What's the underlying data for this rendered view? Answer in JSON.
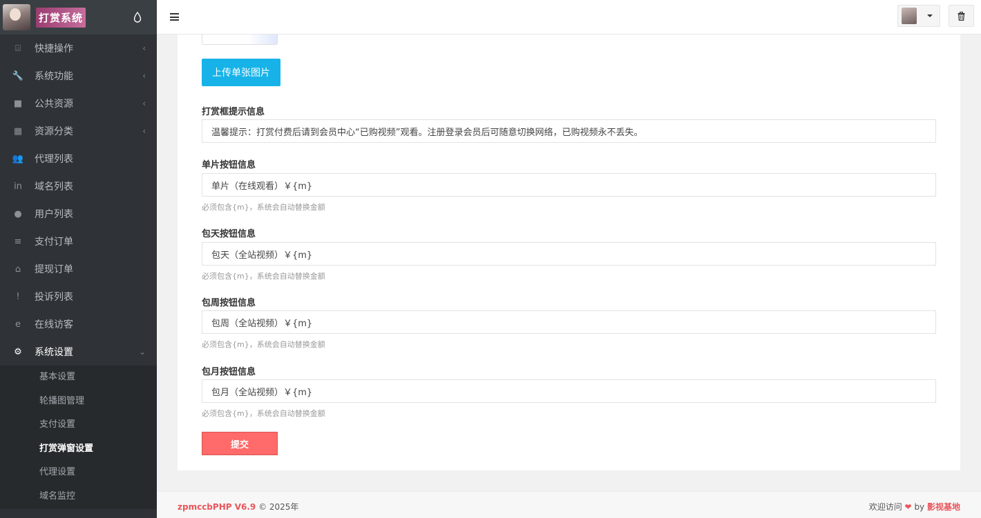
{
  "brand": {
    "title": "打赏系统"
  },
  "sidebar": {
    "items": [
      {
        "label": "快捷操作",
        "icon": "folder-open-icon",
        "glyph": "⌸",
        "has_arrow": true
      },
      {
        "label": "系统功能",
        "icon": "wrench-icon",
        "glyph": "🔧",
        "has_arrow": true
      },
      {
        "label": "公共资源",
        "icon": "video-camera-icon",
        "glyph": "■",
        "has_arrow": true
      },
      {
        "label": "资源分类",
        "icon": "th-large-icon",
        "glyph": "▦",
        "has_arrow": true
      },
      {
        "label": "代理列表",
        "icon": "users-icon",
        "glyph": "👥",
        "has_arrow": false
      },
      {
        "label": "域名列表",
        "icon": "linkedin-icon",
        "glyph": "in",
        "has_arrow": false
      },
      {
        "label": "用户列表",
        "icon": "user-icon",
        "glyph": "●",
        "has_arrow": false
      },
      {
        "label": "支付订单",
        "icon": "database-icon",
        "glyph": "≡",
        "has_arrow": false
      },
      {
        "label": "提现订单",
        "icon": "bank-icon",
        "glyph": "⌂",
        "has_arrow": false
      },
      {
        "label": "投诉列表",
        "icon": "exclamation-circle-icon",
        "glyph": "!",
        "has_arrow": false
      },
      {
        "label": "在线访客",
        "icon": "internet-explorer-icon",
        "glyph": "e",
        "has_arrow": false
      },
      {
        "label": "系统设置",
        "icon": "cog-icon",
        "glyph": "⚙",
        "has_arrow": true,
        "active": true
      }
    ],
    "submenu": [
      "基本设置",
      "轮播图管理",
      "支付设置",
      "打赏弹窗设置",
      "代理设置",
      "域名监控"
    ],
    "submenu_current": "打赏弹窗设置",
    "arrow_left": "‹",
    "arrow_down": "⌄"
  },
  "form": {
    "upload_label": "上传单张图片",
    "fields": [
      {
        "label": "打赏框提示信息",
        "value": "温馨提示：打赏付费后请到会员中心“已购视频”观看。注册登录会员后可随意切换网络，已购视频永不丢失。",
        "hint": ""
      },
      {
        "label": "单片按钮信息",
        "value": "单片（在线观看）￥{m}",
        "hint": "必须包含{m}，系统会自动替换金额"
      },
      {
        "label": "包天按钮信息",
        "value": "包天（全站视频）￥{m}",
        "hint": "必须包含{m}，系统会自动替换金额"
      },
      {
        "label": "包周按钮信息",
        "value": "包周（全站视频）￥{m}",
        "hint": "必须包含{m}，系统会自动替换金额"
      },
      {
        "label": "包月按钮信息",
        "value": "包月（全站视频）￥{m}",
        "hint": "必须包含{m}，系统会自动替换金额"
      }
    ],
    "submit_label": "提交"
  },
  "footer": {
    "brand": "zpmccbPHP V6.9",
    "copyright": "© 2025年",
    "welcome": "欢迎访问",
    "heart": "❤",
    "by": "by",
    "site": "影视基地"
  },
  "colors": {
    "accent": "#17b3e8",
    "submit": "#ff6a6a",
    "brand_red": "#e8555a"
  }
}
